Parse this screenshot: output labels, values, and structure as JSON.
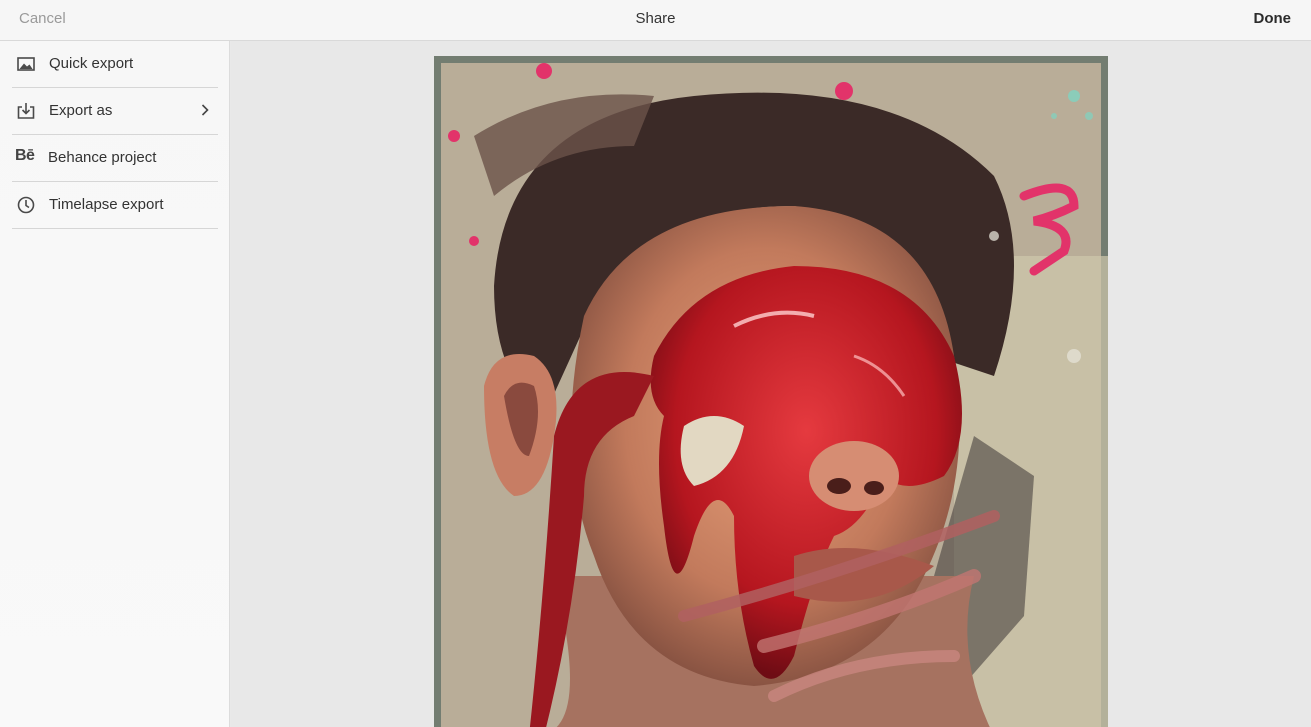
{
  "header": {
    "cancel_label": "Cancel",
    "title": "Share",
    "done_label": "Done"
  },
  "sidebar": {
    "items": [
      {
        "label": "Quick export",
        "icon": "image-icon"
      },
      {
        "label": "Export as",
        "icon": "export-tray-icon",
        "has_chevron": true
      },
      {
        "label": "Behance project",
        "icon": "behance-icon",
        "icon_text": "Bē"
      },
      {
        "label": "Timelapse export",
        "icon": "clock-icon"
      }
    ]
  },
  "colors": {
    "accent_red": "#c8202c",
    "pink": "#e0336b",
    "hair": "#3a2a26",
    "background": "#b8ab96"
  }
}
